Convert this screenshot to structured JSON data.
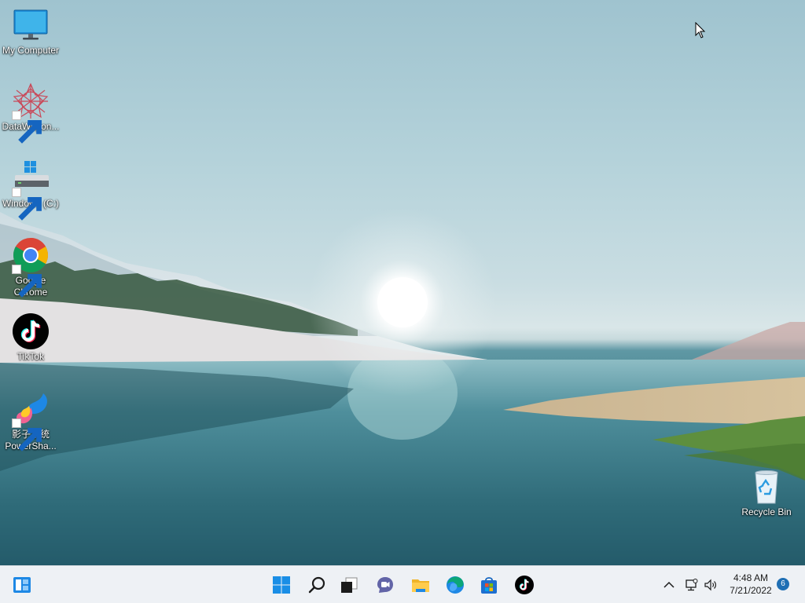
{
  "desktop": {
    "icons": [
      {
        "label": "My Computer",
        "icon": "monitor-icon"
      },
      {
        "label": "DataWagon...",
        "icon": "datawagon-icon",
        "shortcut": true
      },
      {
        "label": "Windows (C:)",
        "icon": "drive-icon",
        "shortcut": true
      },
      {
        "label": "Google Chrome",
        "icon": "chrome-icon",
        "shortcut": true
      },
      {
        "label": "TikTok",
        "icon": "tiktok-icon"
      },
      {
        "label": "影子系统 PowerSha...",
        "icon": "powershadow-icon",
        "shortcut": true
      },
      {
        "label": "Recycle Bin",
        "icon": "recycle-bin-icon"
      }
    ]
  },
  "taskbar": {
    "left": [
      {
        "name": "widgets",
        "icon": "widgets-icon"
      }
    ],
    "center": [
      {
        "name": "start",
        "icon": "windows-start-icon"
      },
      {
        "name": "search",
        "icon": "search-icon"
      },
      {
        "name": "task-view",
        "icon": "task-view-icon"
      },
      {
        "name": "chat",
        "icon": "teams-chat-icon"
      },
      {
        "name": "file-explorer",
        "icon": "folder-icon"
      },
      {
        "name": "edge",
        "icon": "edge-icon"
      },
      {
        "name": "store",
        "icon": "store-icon"
      },
      {
        "name": "tiktok",
        "icon": "tiktok-icon"
      }
    ],
    "tray": {
      "icons": [
        "chevron-up-icon",
        "network-icon",
        "volume-icon"
      ],
      "time": "4:48 AM",
      "date": "7/21/2022",
      "notification_count": "6"
    }
  },
  "colors": {
    "accent": "#0078d4",
    "taskbar_bg": "#eef1f5",
    "icon_text": "#ffffff"
  }
}
